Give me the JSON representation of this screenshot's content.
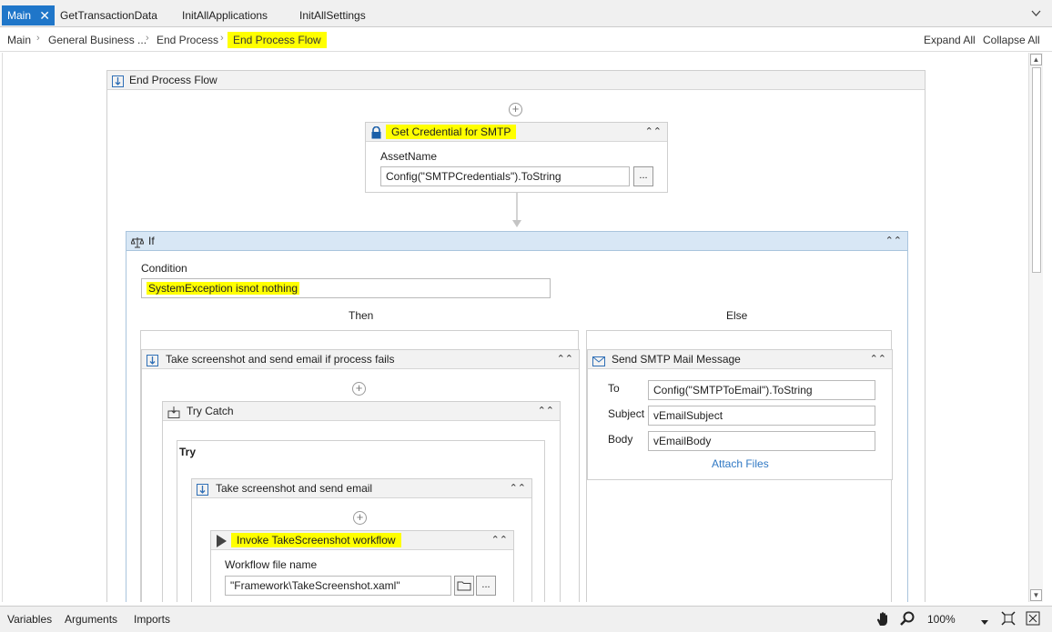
{
  "tabs": [
    {
      "label": "Main",
      "active": true
    },
    {
      "label": "GetTransactionData"
    },
    {
      "label": "InitAllApplications"
    },
    {
      "label": "InitAllSettings"
    }
  ],
  "tab_close_glyph": "✕",
  "tab_overflow_icon": "chevron-down-icon",
  "breadcrumb": [
    "Main",
    "General Business ...",
    "End Process",
    "End Process Flow"
  ],
  "breadcrumb_highlight_color": "#ffff00",
  "expand_all": "Expand All",
  "collapse_all": "Collapse All",
  "flow": {
    "title": "End Process Flow",
    "credential": {
      "title": "Get Credential for SMTP",
      "asset_label": "AssetName",
      "asset_value": "Config(\"SMTPCredentials\").ToString",
      "browse": "..."
    },
    "if_block": {
      "title": "If",
      "condition_label": "Condition",
      "condition_value": "SystemException isnot nothing",
      "then_label": "Then",
      "else_label": "Else"
    },
    "then_seq": {
      "title": "Take screenshot and send email if process fails",
      "try_catch": "Try Catch",
      "try_label": "Try",
      "inner_seq": "Take screenshot and send email",
      "invoke": {
        "title": "Invoke TakeScreenshot workflow",
        "file_label": "Workflow file name",
        "file_value": "\"Framework\\TakeScreenshot.xaml\"",
        "browse": "..."
      }
    },
    "else_mail": {
      "title": "Send SMTP Mail Message",
      "to_label": "To",
      "to_value": "Config(\"SMTPToEmail\").ToString",
      "subject_label": "Subject",
      "subject_value": "vEmailSubject",
      "body_label": "Body",
      "body_value": "vEmailBody",
      "attach": "Attach Files"
    }
  },
  "status": {
    "variables": "Variables",
    "arguments": "Arguments",
    "imports": "Imports",
    "zoom": "100%"
  },
  "accent": "#1f76c9"
}
